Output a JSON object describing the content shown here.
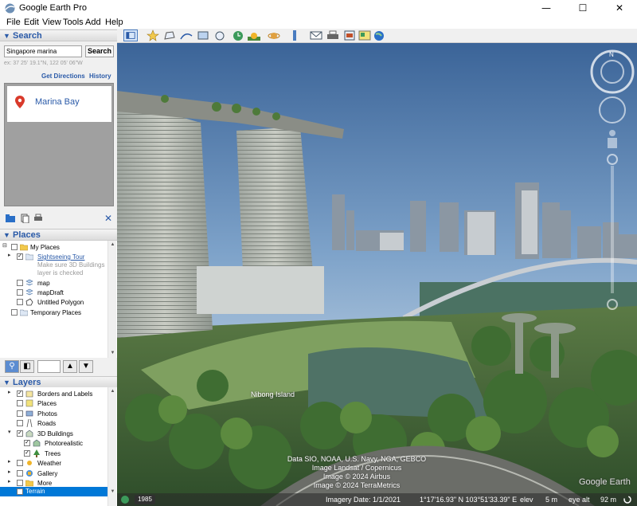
{
  "window": {
    "title": "Google Earth Pro",
    "minimize": "—",
    "maximize": "☐",
    "close": "✕"
  },
  "menu": [
    "File",
    "Edit",
    "View",
    "Tools",
    "Add",
    "Help"
  ],
  "search": {
    "header": "Search",
    "query": "Singapore marina",
    "button": "Search",
    "hint": "ex: 37 25' 19.1\"N, 122 05' 06\"W",
    "get_directions": "Get Directions",
    "history": "History",
    "result": "Marina Bay"
  },
  "places": {
    "header": "Places",
    "items": [
      {
        "label": "My Places"
      },
      {
        "label": "Sightseeing Tour"
      },
      {
        "label": "Make sure 3D Buildings"
      },
      {
        "label": "layer is checked"
      },
      {
        "label": "map"
      },
      {
        "label": "mapDraft"
      },
      {
        "label": "Untitled Polygon"
      },
      {
        "label": "Temporary Places"
      }
    ]
  },
  "layers": {
    "header": "Layers",
    "items": [
      {
        "label": "Borders and Labels"
      },
      {
        "label": "Places"
      },
      {
        "label": "Photos"
      },
      {
        "label": "Roads"
      },
      {
        "label": "3D Buildings"
      },
      {
        "label": "Photorealistic"
      },
      {
        "label": "Trees"
      },
      {
        "label": "Weather"
      },
      {
        "label": "Gallery"
      },
      {
        "label": "More"
      },
      {
        "label": "Terrain"
      }
    ]
  },
  "view": {
    "place_label": "Nibong Island",
    "credits": [
      "Data SIO, NOAA, U.S. Navy, NGA, GEBCO",
      "Image Landsat / Copernicus",
      "Image © 2024 Airbus",
      "Image © 2024 TerraMetrics"
    ],
    "logo": "Google Earth",
    "status": {
      "history_year": "1985",
      "imagery_date": "Imagery Date: 1/1/2021",
      "coords": "1°17'16.93\" N  103°51'33.39\" E",
      "elev_label": "elev",
      "elev_value": "5 m",
      "eye_alt_label": "eye alt",
      "eye_alt_value": "92 m"
    }
  },
  "colors": {
    "accent": "#2a5aa8",
    "selection": "#0078d7"
  }
}
